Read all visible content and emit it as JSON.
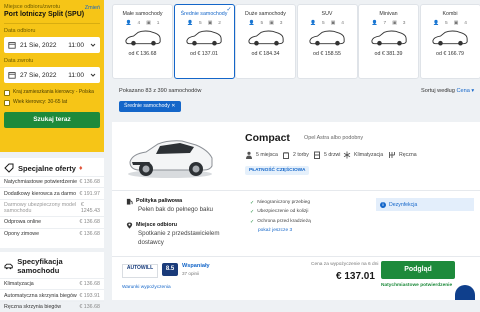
{
  "search": {
    "pickup_label": "Miejsce odbioru/zwrotu",
    "change_link": "Zmień",
    "location": "Port lotniczy Split (SPU)",
    "pickup_date_label": "Data odbioru",
    "pickup_date": "21 Sie, 2022",
    "pickup_time": "11:00",
    "return_date_label": "Data zwrotu",
    "return_date": "27 Sie, 2022",
    "return_time": "11:00",
    "driver_age_checkbox": "Kraj zamieszkania kierowcy - Polska",
    "age_checkbox": "Wiek kierowcy: 30-65 lat",
    "search_button": "Szukaj teraz"
  },
  "offers": {
    "title": "Specjalne oferty",
    "rows": [
      {
        "label": "Natychmiastowe potwierdzenie",
        "price": "€ 136.68"
      },
      {
        "label": "Dodatkowy kierowca za darmo",
        "price": "€ 191.97"
      },
      {
        "label": "Darmowy ubezpieczony model samochodu",
        "price": "€ 1245.43"
      },
      {
        "label": "Odprowa online",
        "price": "€ 136.68"
      },
      {
        "label": "Opony zimowe",
        "price": "€ 136.68"
      }
    ]
  },
  "specs_box": {
    "title": "Specyfikacja samochodu",
    "rows": [
      {
        "label": "Klimatyzacja",
        "price": "€ 136.68"
      },
      {
        "label": "Automatyczna skrzynia biegów",
        "price": "€ 193.91"
      },
      {
        "label": "Ręczna skrzynia biegów",
        "price": "€ 136.68"
      }
    ]
  },
  "tabs": [
    {
      "title": "Małe samochody",
      "seats": "4",
      "bags": "1",
      "price": "od € 136.68",
      "selected": false
    },
    {
      "title": "Średnie samochody",
      "seats": "5",
      "bags": "2",
      "price": "od € 137.01",
      "selected": true
    },
    {
      "title": "Duże samochody",
      "seats": "5",
      "bags": "3",
      "price": "od € 184.34",
      "selected": false
    },
    {
      "title": "SUV",
      "seats": "5",
      "bags": "4",
      "price": "od € 158.55",
      "selected": false
    },
    {
      "title": "Minivan",
      "seats": "7",
      "bags": "3",
      "price": "od € 381.39",
      "selected": false
    },
    {
      "title": "Kombi",
      "seats": "5",
      "bags": "4",
      "price": "od € 166.79",
      "selected": false
    }
  ],
  "results": {
    "count": "Pokazano 83 z 390 samochodów",
    "sort_label": "Sortuj według",
    "sort_value": "Cena",
    "filter_chip": "Średnie samochody ✕"
  },
  "card": {
    "title": "Compact",
    "subtitle": "Opel Astra albo podobny",
    "specs": [
      "5 miejsca",
      "2 torby",
      "5 drzwi",
      "Klimatyzacja",
      "Ręczna"
    ],
    "badge": "PŁATNOŚĆ CZĘŚCIOWA",
    "fuel_title": "Polityka paliwowa",
    "fuel_value": "Pełen bak do pełnego baku",
    "pickup_title": "Miejsce odbioru",
    "pickup_value": "Spotkanie z przedstawicielem dostawcy",
    "checks": [
      "Nieograniczony przebieg",
      "Ubezpieczenie od kolizji",
      "Ochrona przed kradzieżą"
    ],
    "more_terms": "pokaż jeszcze 3",
    "info": "Dezynfekcja",
    "supplier": "AUTOWILL",
    "rating": "8.5",
    "rating_word": "Wspaniały",
    "rating_count": "37 opinii",
    "price_note": "Cena za wypożyczenie na 6 dni",
    "total": "€ 137.01",
    "book_button": "Podgląd",
    "free_cancel": "Natychmiastowe potwierdzenie",
    "rental_terms": "Warunki wypożyczenia"
  }
}
